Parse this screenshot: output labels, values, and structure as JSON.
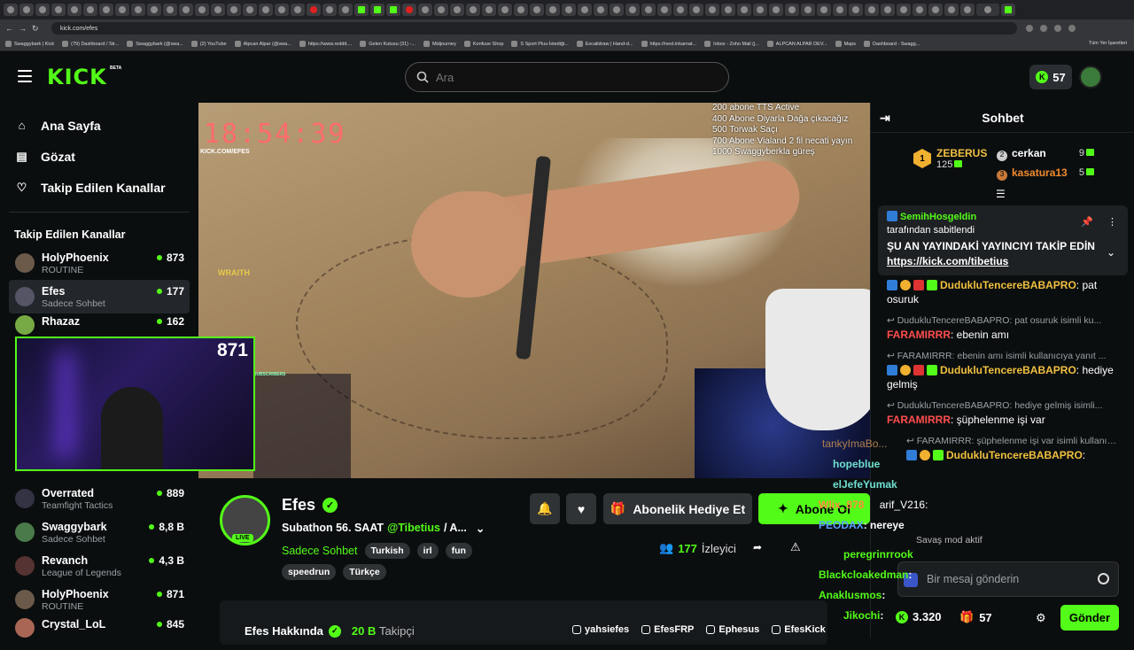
{
  "browser": {
    "url": "kick.com/efes",
    "bookmarks": [
      "Swaggybark | Kick",
      "(79) Dashboard / Str...",
      "Swaggybark (@swa...",
      "(2) YouTube",
      "Alpcan Alpar (@swa...",
      "https://www.reddit....",
      "Gelen Kutusu (31) -...",
      "Midjourney",
      "Konfuse Shop",
      "S Sport Plus-İstediği...",
      "Excalidraw | Hand-d...",
      "https://next.inkarnat...",
      "Inbox - Zoho Mail (j...",
      "ALPCAN ALPAR DEV...",
      "Maps",
      "Dashboard - Swagg..."
    ],
    "bookmarks_right": "Tüm Yer İşaretleri"
  },
  "header": {
    "logo": "KICK",
    "beta": "BETA",
    "search_placeholder": "Ara",
    "kicks": "57"
  },
  "sidebar": {
    "nav": [
      {
        "label": "Ana Sayfa",
        "icon": "home-icon"
      },
      {
        "label": "Gözat",
        "icon": "browse-icon"
      },
      {
        "label": "Takip Edilen Kanallar",
        "icon": "heart-icon"
      }
    ],
    "following_title": "Takip Edilen Kanallar",
    "channels_top": [
      {
        "name": "HolyPhoenix",
        "game": "ROUTINE",
        "viewers": "873"
      },
      {
        "name": "Efes",
        "game": "Sadece Sohbet",
        "viewers": "177"
      },
      {
        "name": "Rhazaz",
        "game": "",
        "viewers": "162"
      }
    ],
    "pip_viewers": "871",
    "channels_bottom": [
      {
        "name": "Overrated",
        "game": "Teamfight Tactics",
        "viewers": "889"
      },
      {
        "name": "Swaggybark",
        "game": "Sadece Sohbet",
        "viewers": "8,8 B"
      },
      {
        "name": "Revanch",
        "game": "League of Legends",
        "viewers": "4,3 B"
      },
      {
        "name": "HolyPhoenix",
        "game": "ROUTINE",
        "viewers": "871"
      },
      {
        "name": "Crystal_LoL",
        "game": "",
        "viewers": "845"
      }
    ]
  },
  "video": {
    "clock": "18:54:39",
    "channel_url": "KICK.COM/EFES",
    "goals": [
      "200 abone TTS Active",
      "400 Abone Diyarla Dağa çıkacağız",
      "500 Torwak Saçı",
      "700 Abone Vialand 2 fil necati yayın",
      "1000 Swaggyberkla güreş"
    ],
    "wraith": "WRAITH",
    "subs_label": "SUBSCRIBERS"
  },
  "stream": {
    "name": "Efes",
    "live": "LIVE",
    "title_prefix": "Subathon 56. SAAT",
    "title_mention": "@Tibetius",
    "title_suffix": "/ A...",
    "category": "Sadece Sohbet",
    "tags1": [
      "Turkish",
      "irl",
      "fun"
    ],
    "tags2": [
      "speedrun",
      "Türkçe"
    ],
    "gift_label": "Abonelik Hediye Et",
    "sub_label": "Abone Ol",
    "viewers": "177",
    "viewers_label": "İzleyici",
    "about_title": "Efes Hakkında",
    "followers_count": "20 B",
    "followers_label": "Takipçi",
    "socials": [
      "yahsiefes",
      "EfesFRP",
      "Ephesus",
      "EfesKick"
    ]
  },
  "chat": {
    "title": "Sohbet",
    "leader_top": {
      "rank": "1",
      "name": "ZEBERUS",
      "count": "125"
    },
    "leader_list": [
      {
        "rank": "2",
        "name": "cerkan",
        "count": "9"
      },
      {
        "rank": "3",
        "name": "kasatura13",
        "count": "5"
      }
    ],
    "pinned": {
      "user": "SemihHosgeldin",
      "by_label": "tarafından sabitlendi",
      "message": "ŞU AN YAYINDAKİ YAYINCIYI TAKİP EDİN",
      "link": "https://kick.com/tibetius"
    },
    "messages": [
      {
        "reply": "",
        "user": "DudukluTencereBABAPRO",
        "text": "pat osuruk"
      },
      {
        "reply": "DudukluTencereBABAPRO: pat osuruk isimli ku...",
        "user": "FARAMIRRR",
        "text": "ebenin amı"
      },
      {
        "reply": "FARAMIRRR: ebenin amı isimli kullanıcıya yanıt ...",
        "user": "DudukluTencereBABAPRO",
        "text": "hediye gelmiş"
      },
      {
        "reply": "DudukluTencereBABAPRO: hediye gelmiş isimli...",
        "user": "FARAMIRRR",
        "text": "şüphelenme işi var"
      }
    ],
    "floating": [
      {
        "user": "tankyIma",
        "text": "Bo..."
      },
      {
        "user": "hopeblue",
        "text": ""
      },
      {
        "user": "elJefeYumak",
        "text": ""
      },
      {
        "user": "Wlix_878",
        "text": ""
      },
      {
        "user": "PEODAX",
        "text": ": nereye"
      },
      {
        "user": "peregrinrrook",
        "text": ""
      },
      {
        "user": "Blackcloakedman",
        "text": ":"
      },
      {
        "user": "Anaklusmos",
        "text": ":"
      },
      {
        "user": "Jikochi",
        "text": ":"
      }
    ],
    "overlay_reply": "FARAMIRRR: şüphelenme işi var isimli kullanıcı...",
    "overlay_user": "DudukluTencereBABAPRO",
    "overlay_mod": "Savaş mod aktif",
    "overlay_v216": "arif_V216:",
    "input_placeholder": "Bir mesaj gönderin",
    "coins": "3.320",
    "gifts": "57",
    "send_label": "Gönder"
  }
}
